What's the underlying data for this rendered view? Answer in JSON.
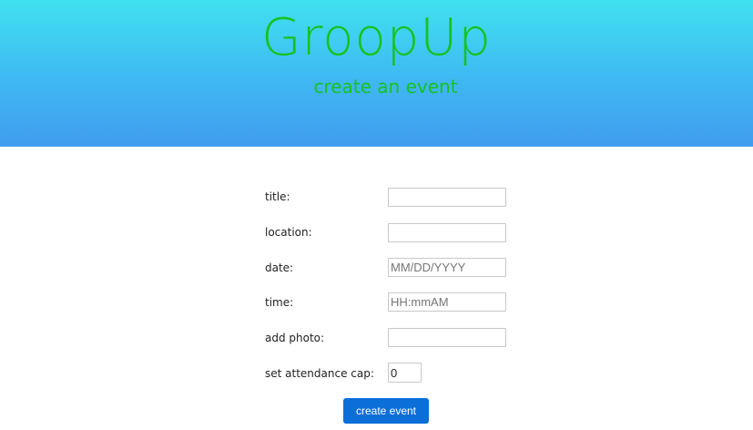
{
  "header": {
    "brand": "GroopUp",
    "subtitle": "create an event"
  },
  "form": {
    "fields": [
      {
        "label": "title:",
        "value": "",
        "placeholder": ""
      },
      {
        "label": "location:",
        "value": "",
        "placeholder": ""
      },
      {
        "label": "date:",
        "value": "",
        "placeholder": "MM/DD/YYYY"
      },
      {
        "label": "time:",
        "value": "",
        "placeholder": "HH:mmAM"
      },
      {
        "label": "add photo:",
        "value": "",
        "placeholder": ""
      },
      {
        "label": "set attendance cap:",
        "value": "0",
        "placeholder": ""
      }
    ],
    "submit_label": "create event"
  },
  "colors": {
    "header_gradient_top": "#40e1f0",
    "header_gradient_bottom": "#419df0",
    "brand_text": "#16c21f",
    "button_bg": "#0c6fd9",
    "button_text": "#ffffff"
  }
}
